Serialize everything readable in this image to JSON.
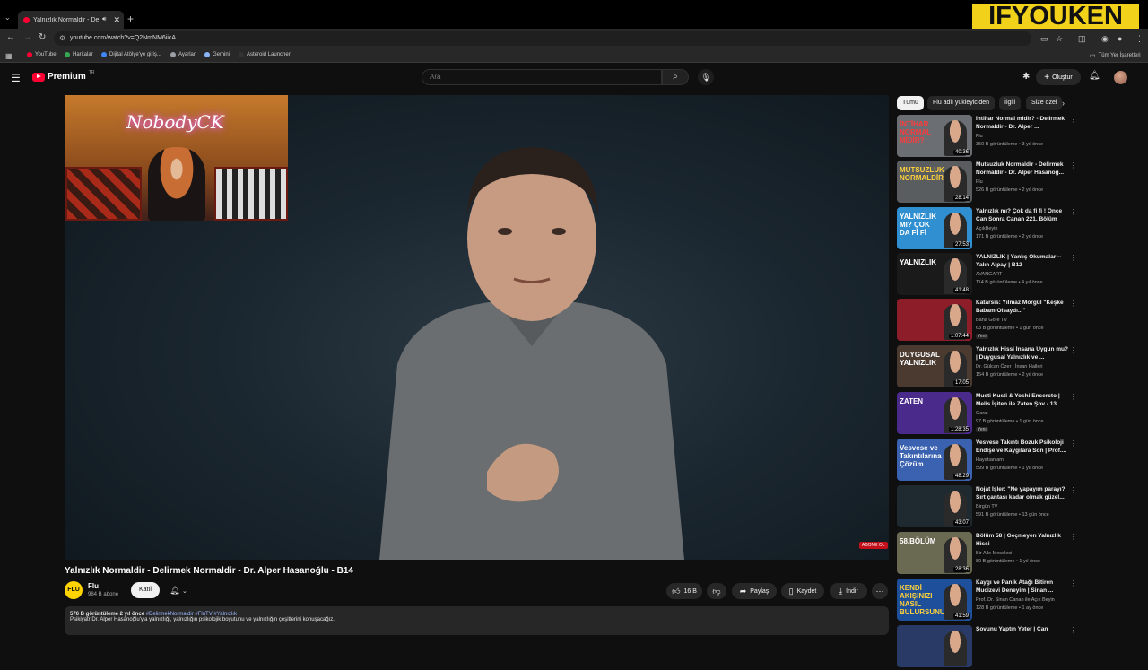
{
  "browser": {
    "tab_title": "Yalnızlık Normaldir - Delirm",
    "tab_close": "✕",
    "new_tab": "+",
    "url": "youtube.com/watch?v=Q2NmNM6iicA",
    "bookmarks": [
      "YouTube",
      "Haritalar",
      "Dijital Atölye'ye giriş...",
      "Ayarlar",
      "Gemini",
      "Asteroid Launcher"
    ],
    "all_bookmarks": "Tüm Yer İşaretleri"
  },
  "overlay_brand": "IFYOUKEN",
  "youtube": {
    "logo_text": "Premium",
    "logo_region": "TR",
    "search_placeholder": "Ara",
    "create_label": "Oluştur"
  },
  "video": {
    "pip_neon": "NobodyCK",
    "subscribe_overlay": "ABONE OL",
    "title": "Yalnızlık Normaldir - Delirmek Normaldir - Dr. Alper Hasanoğlu - B14",
    "channel": "Flu",
    "channel_logo": "FLU",
    "subscribers": "984 B abone",
    "join_label": "Katıl",
    "likes": "16 B",
    "share_label": "Paylaş",
    "save_label": "Kaydet",
    "download_label": "İndir",
    "desc_views": "576 B görüntüleme  2 yıl önce",
    "desc_tags": "#DelirmekNormaldir #FluTV #Yalnızlık",
    "desc_text": "Psikiyatr Dr. Alper Hasanoğlu'yla yalnızlığı, yalnızlığın psikolojik boyutunu ve yalnızlığın çeşitlerini konuşacağız."
  },
  "sidebar": {
    "chips": [
      "Tümü",
      "Flu adlı yükleyiciden",
      "İlgili",
      "Size özel"
    ],
    "items": [
      {
        "title": "İntihar Normal midir? - Delirmek Normaldir - Dr. Alper ...",
        "channel": "Flu",
        "meta": "350 B görüntüleme • 3 yıl önce",
        "duration": "40:36",
        "caption": "İNTİHAR NORMAL MİDİR?",
        "bg": "#6b6f74",
        "cap_color": "#ff3b3b",
        "badge": ""
      },
      {
        "title": "Mutsuzluk Normaldir - Delirmek Normaldir - Dr. Alper Hasanoğ...",
        "channel": "Flu",
        "meta": "526 B görüntüleme • 2 yıl önce",
        "duration": "28:14",
        "caption": "MUTSUZLUK NORMALDİR",
        "bg": "#5a5d60",
        "cap_color": "#ffd23a",
        "badge": ""
      },
      {
        "title": "Yalnızlık mı? Çok da fi fi ! Önce Can Sonra Canan 221. Bölüm",
        "channel": "AçıkBeyin",
        "meta": "171 B görüntüleme • 2 yıl önce",
        "duration": "27:53",
        "caption": "YALNIZLIK MI? ÇOK DA Fİ Fİ",
        "bg": "#2f8fd0",
        "cap_color": "#ffffff",
        "badge": ""
      },
      {
        "title": "YALNIZLIK | Yanlış Okumalar -- Yalın Alpay | B12",
        "channel": "AVANGART",
        "meta": "114 B görüntüleme • 4 yıl önce",
        "duration": "41:48",
        "caption": "YALNIZLIK",
        "bg": "#1a1a1a",
        "cap_color": "#ffffff",
        "badge": ""
      },
      {
        "title": "Katarsis: Yılmaz Morgül \"Keşke Babam Olsaydı...\"",
        "channel": "Bana Göre TV",
        "meta": "63 B görüntüleme • 1 gün önce",
        "duration": "1:07:44",
        "caption": "",
        "bg": "#8e1d2a",
        "cap_color": "#ffffff",
        "badge": "Yeni"
      },
      {
        "title": "Yalnızlık Hissi İnsana Uygun mu? | Duygusal Yalnızlık ve ...",
        "channel": "Dr. Gülcan Özer | İnsan Halleri",
        "meta": "154 B görüntüleme • 2 yıl önce",
        "duration": "17:05",
        "caption": "DUYGUSAL YALNIZLIK",
        "bg": "#4a3a30",
        "cap_color": "#ffffff",
        "badge": ""
      },
      {
        "title": "Musti Kusti & Yoshi Encercto | Melis İşiten ile Zaten Şov - 13...",
        "channel": "Garaj",
        "meta": "97 B görüntüleme • 1 gün önce",
        "duration": "1:28:35",
        "caption": "ZATEN",
        "bg": "#4a2a8a",
        "cap_color": "#ffffff",
        "badge": "Yeni"
      },
      {
        "title": "Vesvese Takıntı Bozuk Psikoloji Endişe ve Kaygılara Son | Prof....",
        "channel": "Hayatıanlam",
        "meta": "599 B görüntüleme • 1 yıl önce",
        "duration": "48:29",
        "caption": "Vesvese ve Takıntılarına Çözüm",
        "bg": "#3a62b0",
        "cap_color": "#ffffff",
        "badge": ""
      },
      {
        "title": "Nojat İşler: \"Ne yapayım parayı? Sırt çantası kadar olmak güzel...",
        "channel": "Birgün TV",
        "meta": "591 B görüntüleme • 13 gün önce",
        "duration": "43:07",
        "caption": "",
        "bg": "#1e2a30",
        "cap_color": "#ffffff",
        "badge": ""
      },
      {
        "title": "Bölüm 58 | Geçmeyen Yalnızlık Hissi",
        "channel": "Bir Aile Meselesi",
        "meta": "80 B görüntüleme • 1 yıl önce",
        "duration": "28:36",
        "caption": "58.BÖLÜM",
        "bg": "#6a6a52",
        "cap_color": "#ffffff",
        "badge": ""
      },
      {
        "title": "Kaygı ve Panik Atağı Bitiren Mucizevi Deneyim | Sinan ...",
        "channel": "Prof. Dr. Sinan Canan ile Açık Beyin",
        "meta": "128 B görüntüleme • 1 ay önce",
        "duration": "41:59",
        "caption": "KENDİ AKIŞINIZI NASIL BULURSUNUZ?",
        "bg": "#1d4f9a",
        "cap_color": "#ffd23a",
        "badge": ""
      },
      {
        "title": "Şovunu Yaptın Yeter | Can",
        "channel": "",
        "meta": "",
        "duration": "",
        "caption": "",
        "bg": "#2a3a66",
        "cap_color": "#ffffff",
        "badge": ""
      }
    ]
  },
  "colors": {
    "accent_red": "#ff0033",
    "brand_yellow": "#f2d11a",
    "background": "#0f0f0f"
  }
}
